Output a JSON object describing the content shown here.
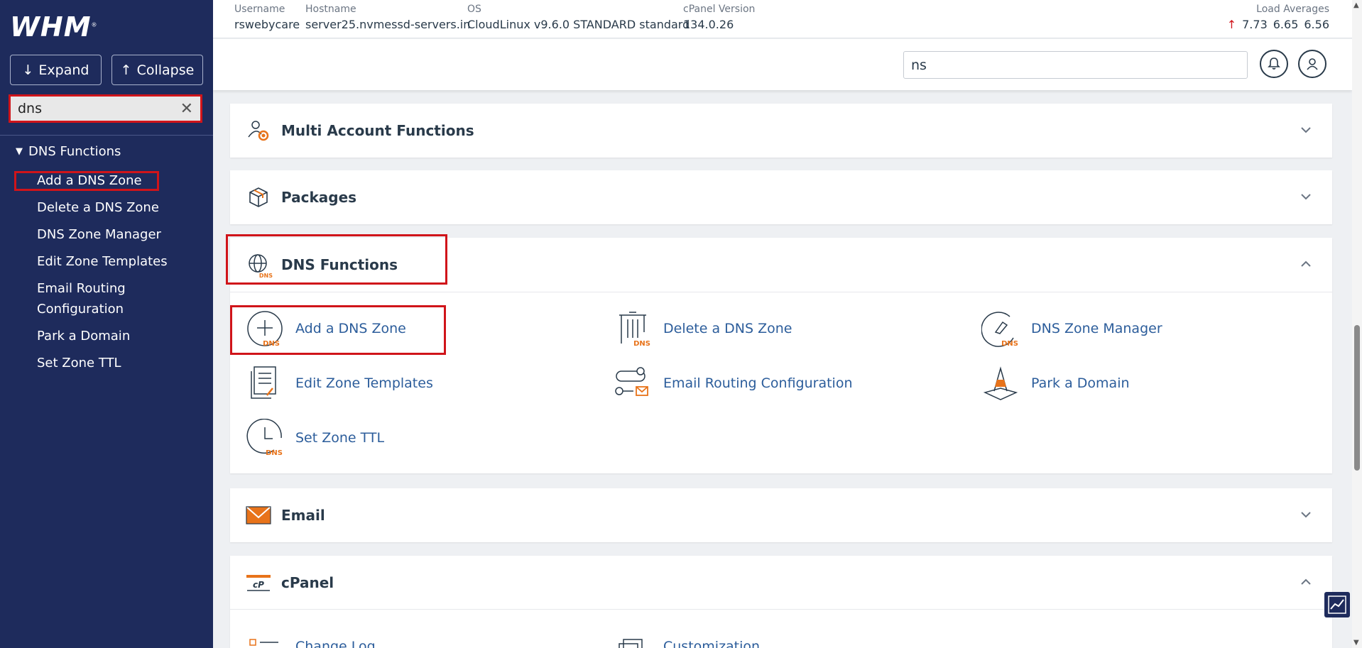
{
  "sidebar": {
    "logo": "WHM",
    "expand_label": "Expand",
    "collapse_label": "Collapse",
    "search_value": "dns",
    "group_label": "DNS Functions",
    "items": [
      {
        "label": "Add a DNS Zone"
      },
      {
        "label": "Delete a DNS Zone"
      },
      {
        "label": "DNS Zone Manager"
      },
      {
        "label": "Edit Zone Templates"
      },
      {
        "label": "Email Routing"
      },
      {
        "label": "Configuration"
      },
      {
        "label": "Park a Domain"
      },
      {
        "label": "Set Zone TTL"
      }
    ]
  },
  "stats": {
    "username_label": "Username",
    "username": "rswebycare",
    "hostname_label": "Hostname",
    "hostname": "server25.nvmessd-servers.in",
    "os_label": "OS",
    "os": "CloudLinux v9.6.0 STANDARD standard",
    "cpanel_label": "cPanel Version",
    "cpanel": "134.0.26",
    "load_label": "Load Averages",
    "load1": "7.73",
    "load5": "6.65",
    "load15": "6.56"
  },
  "header": {
    "search_value": "ns"
  },
  "sections": {
    "multi_account": "Multi Account Functions",
    "packages": "Packages",
    "dns": "DNS Functions",
    "email": "Email",
    "cpanel": "cPanel"
  },
  "dns_items": [
    {
      "label": "Add a DNS Zone",
      "icon": "add-dns-icon"
    },
    {
      "label": "Delete a DNS Zone",
      "icon": "delete-dns-icon"
    },
    {
      "label": "DNS Zone Manager",
      "icon": "dns-manager-icon"
    },
    {
      "label": "Edit Zone Templates",
      "icon": "template-icon"
    },
    {
      "label": "Email Routing Configuration",
      "icon": "routing-icon"
    },
    {
      "label": "Park a Domain",
      "icon": "cone-icon"
    },
    {
      "label": "Set Zone TTL",
      "icon": "clock-icon"
    }
  ],
  "cpanel_items": [
    {
      "label": "Change Log"
    },
    {
      "label": "Customization"
    }
  ],
  "colors": {
    "sidebar": "#1e2b5c",
    "highlight": "#d0141a",
    "link": "#2c5d9b",
    "accent": "#e8731a"
  }
}
